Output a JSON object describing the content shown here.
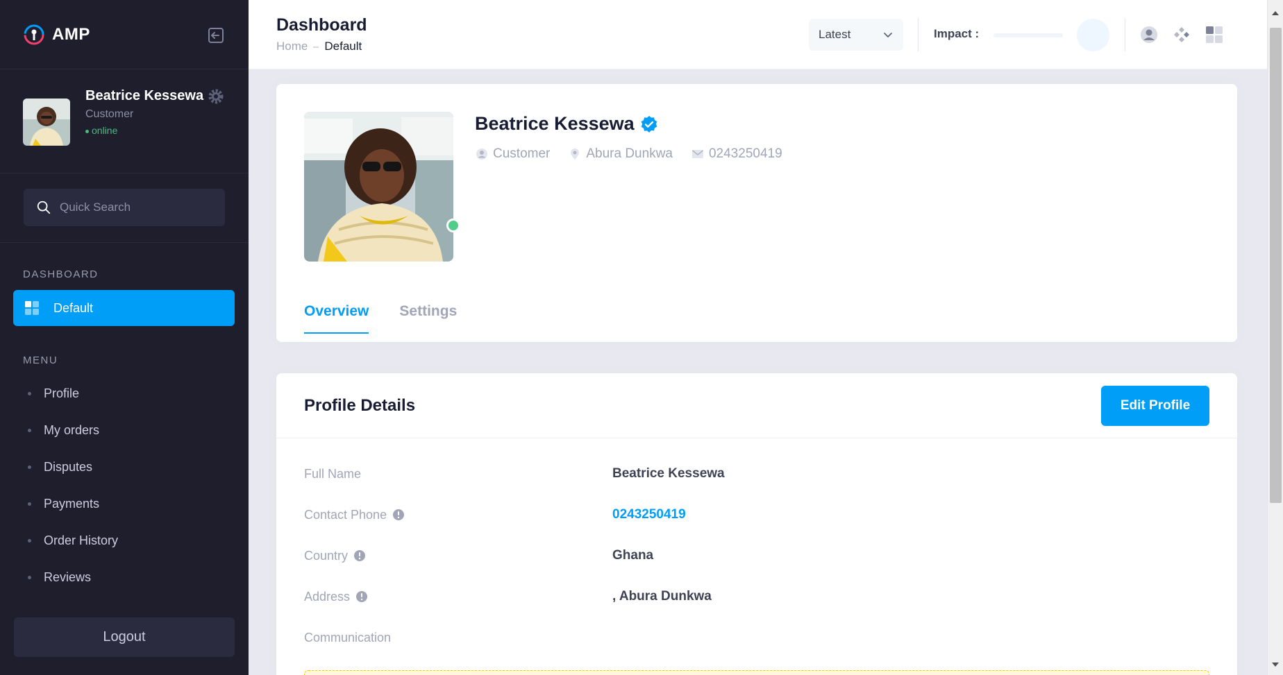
{
  "app": {
    "name": "AMP"
  },
  "sidebar": {
    "user": {
      "name": "Beatrice Kessewa",
      "role": "Customer",
      "status": "online"
    },
    "search": {
      "placeholder": "Quick Search"
    },
    "dashboard_label": "DASHBOARD",
    "dashboard_item": "Default",
    "menu_label": "MENU",
    "menu_items": [
      {
        "label": "Profile"
      },
      {
        "label": "My orders"
      },
      {
        "label": "Disputes"
      },
      {
        "label": "Payments"
      },
      {
        "label": "Order History"
      },
      {
        "label": "Reviews"
      }
    ],
    "logout_label": "Logout"
  },
  "header": {
    "title": "Dashboard",
    "breadcrumb": {
      "home": "Home",
      "current": "Default"
    },
    "filter": {
      "selected": "Latest"
    },
    "impact": {
      "label": "Impact :",
      "progress": 0
    }
  },
  "profile": {
    "name": "Beatrice Kessewa",
    "role": "Customer",
    "location": "Abura Dunkwa",
    "phone": "0243250419",
    "tabs": [
      {
        "label": "Overview",
        "active": true
      },
      {
        "label": "Settings",
        "active": false
      }
    ]
  },
  "details": {
    "title": "Profile Details",
    "edit_label": "Edit Profile",
    "rows": [
      {
        "label": "Full Name",
        "value": "Beatrice Kessewa",
        "info": false,
        "link": false
      },
      {
        "label": "Contact Phone",
        "value": "0243250419",
        "info": true,
        "link": true
      },
      {
        "label": "Country",
        "value": "Ghana",
        "info": true,
        "link": false
      },
      {
        "label": "Address",
        "value": ", Abura Dunkwa",
        "info": true,
        "link": false
      },
      {
        "label": "Communication",
        "value": "",
        "info": false,
        "link": false
      }
    ]
  },
  "colors": {
    "primary": "#009ef7",
    "sidebar": "#1e1e2d",
    "success": "#50cd89"
  }
}
